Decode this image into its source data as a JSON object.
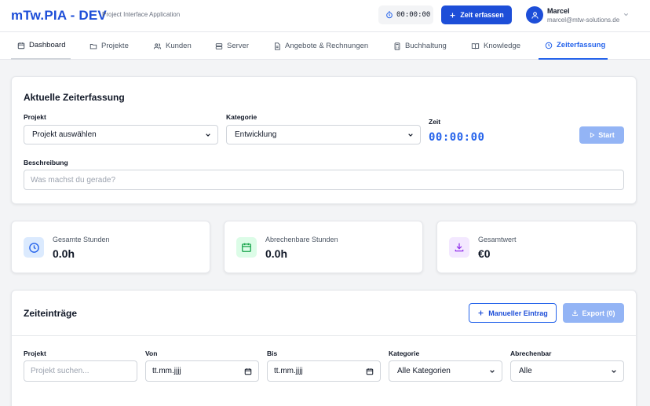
{
  "header": {
    "brand": "mTw.PIA - DEV",
    "subtitle": "Project Interface Application",
    "timer": "00:00:00",
    "add_time_label": "Zeit erfassen",
    "user_name": "Marcel",
    "user_email": "marcel@mtw-solutions.de"
  },
  "nav": {
    "items": [
      {
        "label": "Dashboard",
        "icon": "calendar-icon"
      },
      {
        "label": "Projekte",
        "icon": "folder-icon"
      },
      {
        "label": "Kunden",
        "icon": "users-icon"
      },
      {
        "label": "Server",
        "icon": "server-icon"
      },
      {
        "label": "Angebote & Rechnungen",
        "icon": "document-icon"
      },
      {
        "label": "Buchhaltung",
        "icon": "calculator-icon"
      },
      {
        "label": "Knowledge",
        "icon": "book-icon"
      },
      {
        "label": "Zeiterfassung",
        "icon": "clock-icon"
      }
    ],
    "active": "Zeiterfassung"
  },
  "current": {
    "title": "Aktuelle Zeiterfassung",
    "project_label": "Projekt",
    "project_value": "Projekt auswählen",
    "category_label": "Kategorie",
    "category_value": "Entwicklung",
    "time_label": "Zeit",
    "time_value": "00:00:00",
    "start_label": "Start",
    "description_label": "Beschreibung",
    "description_placeholder": "Was machst du gerade?"
  },
  "stats": [
    {
      "label": "Gesamte Stunden",
      "value": "0.0h",
      "icon": "clock-icon",
      "color": "#2563eb",
      "bg": "#dbeafe"
    },
    {
      "label": "Abrechenbare Stunden",
      "value": "0.0h",
      "icon": "calendar-icon",
      "color": "#16a34a",
      "bg": "#dcfce7"
    },
    {
      "label": "Gesamtwert",
      "value": "€0",
      "icon": "download-icon",
      "color": "#9333ea",
      "bg": "#f3e8ff"
    }
  ],
  "entries": {
    "title": "Zeiteinträge",
    "manual_label": "Manueller Eintrag",
    "export_label": "Export (0)",
    "filters": {
      "project_label": "Projekt",
      "project_placeholder": "Projekt suchen...",
      "from_label": "Von",
      "from_value": "tt.mm.jjjj",
      "to_label": "Bis",
      "to_value": "tt.mm.jjjj",
      "category_label": "Kategorie",
      "category_value": "Alle Kategorien",
      "billable_label": "Abrechenbar",
      "billable_value": "Alle"
    }
  }
}
